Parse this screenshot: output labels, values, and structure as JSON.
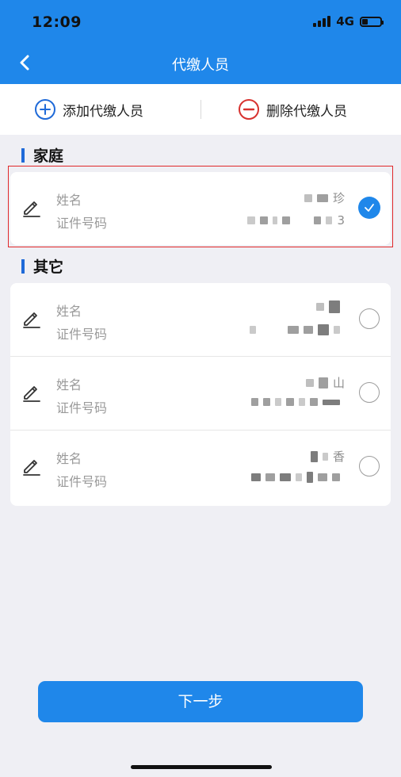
{
  "status_bar": {
    "time": "12:09",
    "network": "4G",
    "battery_level": 0.3,
    "icons": [
      "signal-icon",
      "battery-icon"
    ]
  },
  "header": {
    "title": "代缴人员",
    "back_icon": "chevron-left-icon"
  },
  "actions": {
    "add_label": "添加代缴人员",
    "delete_label": "删除代缴人员",
    "add_icon": "plus-circle-icon",
    "delete_icon": "minus-circle-icon"
  },
  "sections": {
    "family": {
      "title": "家庭",
      "people": [
        {
          "name_label": "姓名",
          "id_label": "证件号码",
          "name_suffix": "珍",
          "id_suffix": "3",
          "selected": true
        }
      ]
    },
    "other": {
      "title": "其它",
      "people": [
        {
          "name_label": "姓名",
          "id_label": "证件号码",
          "name_suffix": "",
          "id_suffix": "",
          "selected": false
        },
        {
          "name_label": "姓名",
          "id_label": "证件号码",
          "name_suffix": "山",
          "id_suffix": "",
          "selected": false
        },
        {
          "name_label": "姓名",
          "id_label": "证件号码",
          "name_suffix": "香",
          "id_suffix": "",
          "selected": false
        }
      ]
    }
  },
  "footer": {
    "next_label": "下一步"
  },
  "colors": {
    "primary": "#1f87ea",
    "background": "#efeff4",
    "delete_red": "#e0282a",
    "section_bar": "#1f6ad8"
  }
}
